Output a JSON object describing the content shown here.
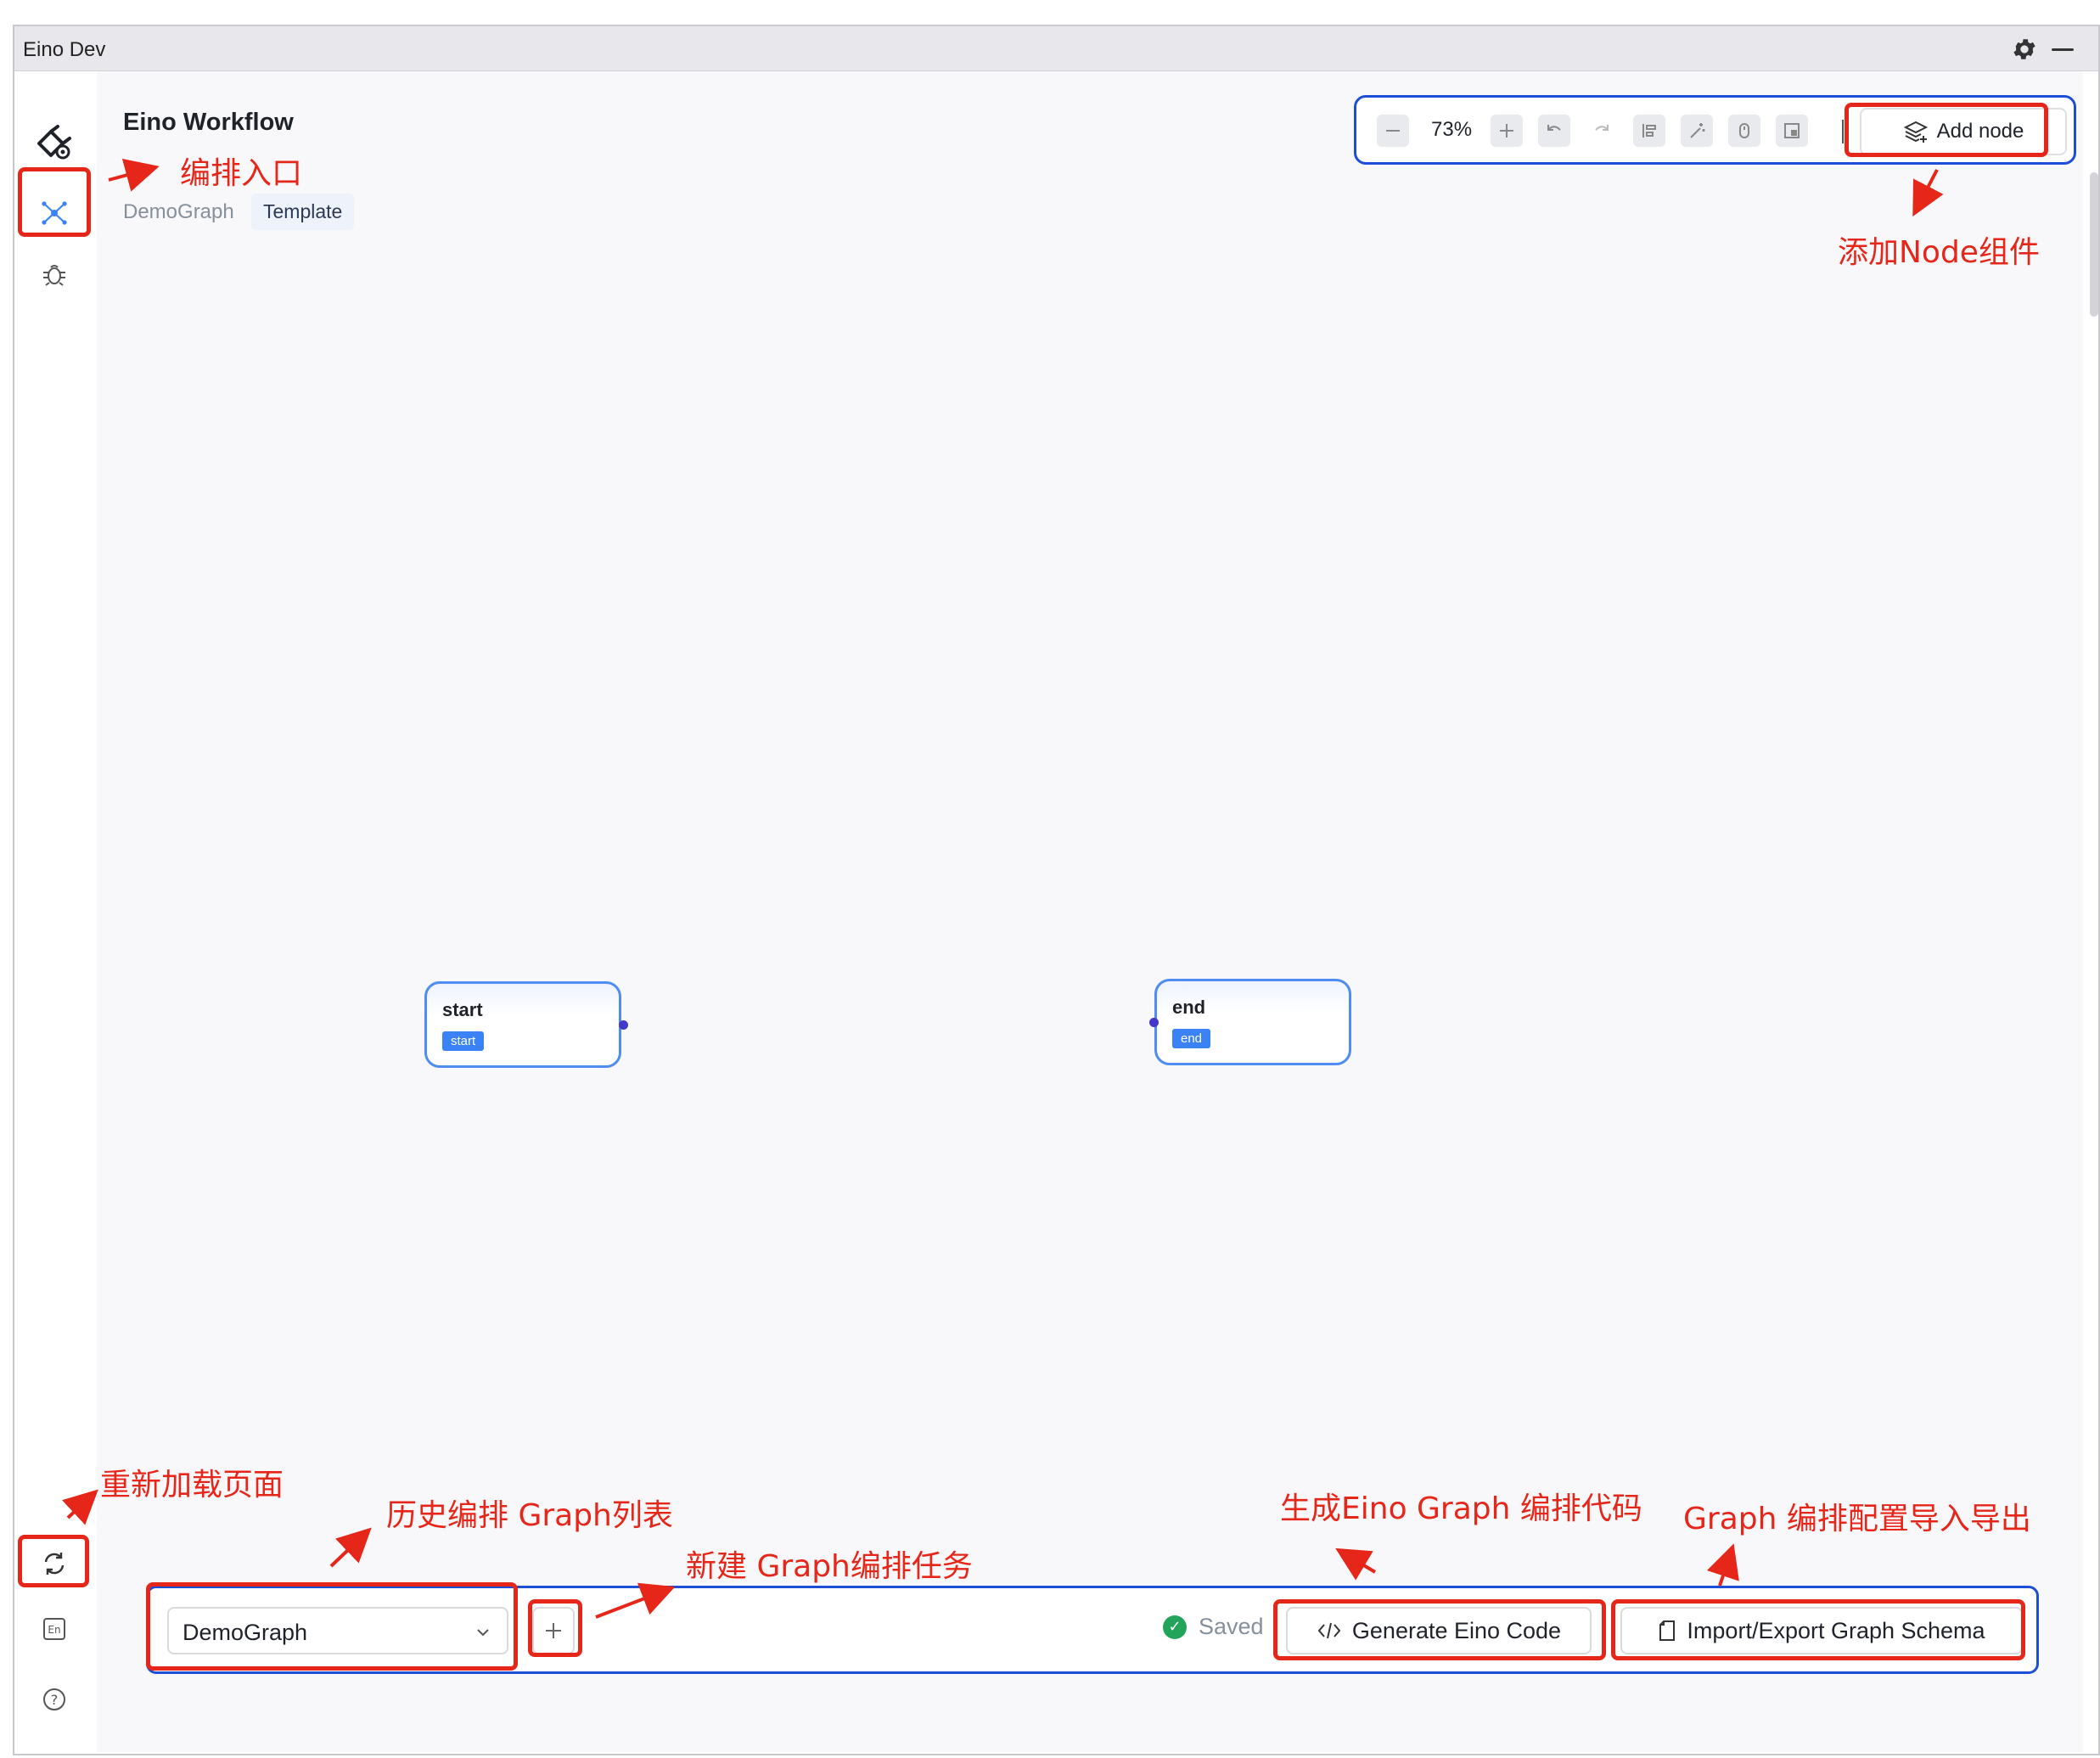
{
  "window": {
    "title": "Eino Dev"
  },
  "app": {
    "title": "Eino Workflow"
  },
  "breadcrumb": {
    "graph": "DemoGraph",
    "tag": "Template"
  },
  "toolbar": {
    "zoom": "73%",
    "add_node_label": "Add node"
  },
  "nodes": [
    {
      "title": "start",
      "badge": "start"
    },
    {
      "title": "end",
      "badge": "end"
    }
  ],
  "bottom": {
    "graph_select_value": "DemoGraph",
    "saved_label": "Saved",
    "generate_label": "Generate Eino Code",
    "import_export_label": "Import/Export Graph Schema"
  },
  "annotations": {
    "orchestration_entry": "编排入口",
    "add_node_component": "添加Node组件",
    "reload_page": "重新加载页面",
    "history_graph_list": "历史编排 Graph列表",
    "new_graph_task": "新建 Graph编排任务",
    "generate_code": "生成Eino Graph 编排代码",
    "import_export_config": "Graph 编排配置导入导出"
  },
  "colors": {
    "accent": "#4f8cf3",
    "annotation": "#e7261a",
    "frame": "#1d4ed8",
    "saved": "#22a55a"
  },
  "icons": [
    "eino-logo-icon",
    "graph-nodes-icon",
    "debug-bug-icon",
    "reload-icon",
    "language-en-icon",
    "help-icon",
    "gear-icon",
    "minimize-icon",
    "zoom-out-icon",
    "zoom-in-icon",
    "undo-icon",
    "redo-icon",
    "layout-icon",
    "magic-wand-icon",
    "mouse-icon",
    "minimap-icon",
    "layers-add-icon",
    "chevron-down-icon",
    "plus-icon",
    "check-circle-icon",
    "code-icon",
    "file-icon"
  ]
}
